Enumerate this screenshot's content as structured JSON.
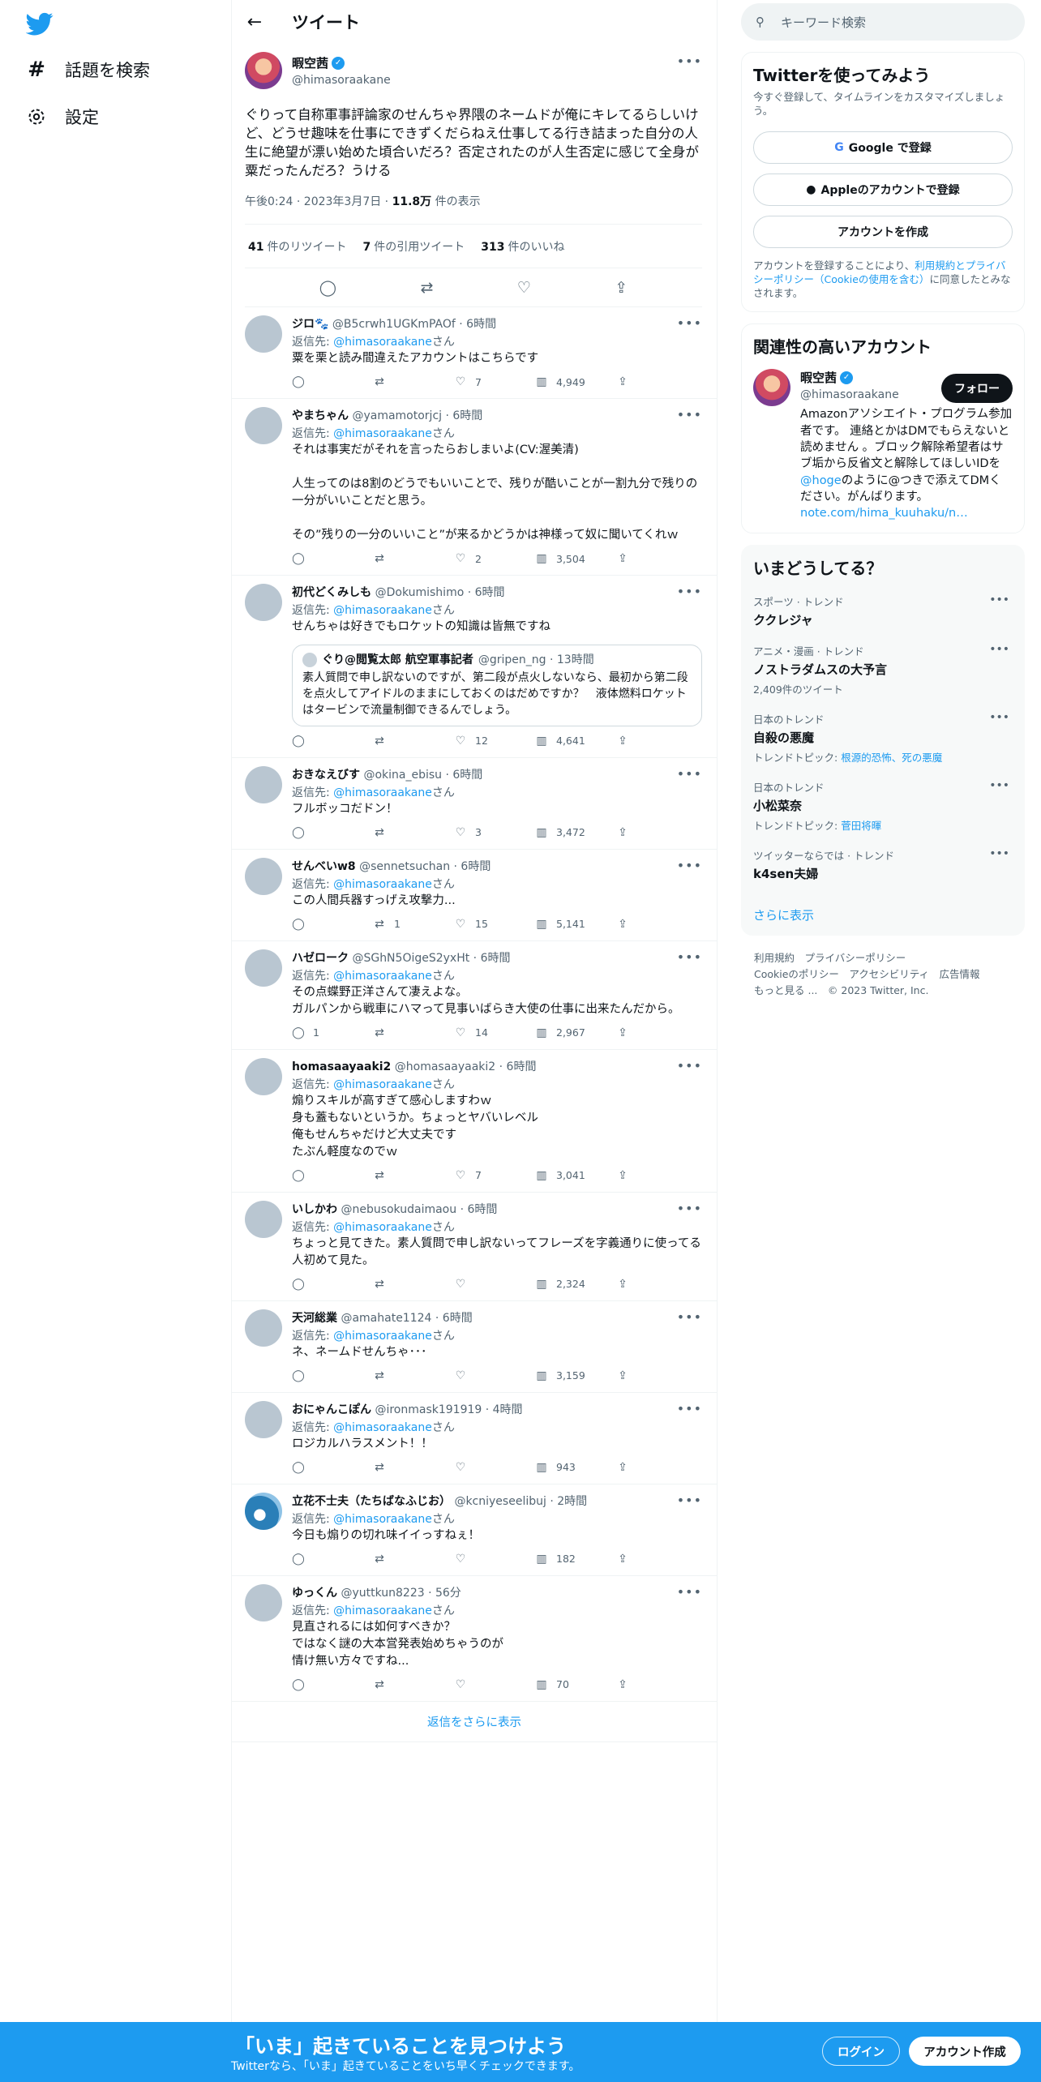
{
  "nav": {
    "explore_label": "話題を検索",
    "settings_label": "設定"
  },
  "header": {
    "title": "ツイート"
  },
  "focal": {
    "name": "暇空茜",
    "handle": "@himasoraakane",
    "text": "ぐりって自称軍事評論家のせんちゃ界隈のネームドが俺にキレてるらしいけど、どうせ趣味を仕事にできずくだらねえ仕事してる行き詰まった自分の人生に絶望が漂い始めた頃合いだろ？否定されたのが人生否定に感じて全身が粟だったんだろ？うける",
    "time": "午後0:24 · 2023年3月7日 · ",
    "views": "11.8万",
    "views_suffix": " 件の表示",
    "retweets": "41",
    "retweets_label": "件のリツイート",
    "quotes": "7",
    "quotes_label": "件の引用ツイート",
    "likes": "313",
    "likes_label": "件のいいね"
  },
  "replies": [
    {
      "name": "ジロ🐾",
      "meta": "@B5crwh1UGKmPAOf · 6時間",
      "to_prefix": "返信先: ",
      "to": "@himasoraakane",
      "to_suffix": "さん",
      "text": "粟を栗と読み間違えたアカウントはこちらです",
      "comments": "",
      "retweets": "",
      "likes": "7",
      "views": "4,949"
    },
    {
      "name": "やまちゃん",
      "meta": "@yamamotorjcj · 6時間",
      "to_prefix": "返信先: ",
      "to": "@himasoraakane",
      "to_suffix": "さん",
      "text": "それは事実だがそれを言ったらおしまいよ(CV:渥美清)\n\n人生ってのは8割のどうでもいいことで、残りが酷いことが一割九分で残りの一分がいいことだと思う。\n\nその”残りの一分のいいこと”が来るかどうかは神様って奴に聞いてくれｗ",
      "comments": "",
      "retweets": "",
      "likes": "2",
      "views": "3,504"
    },
    {
      "name": "初代どくみしも",
      "meta": "@Dokumishimo · 6時間",
      "to_prefix": "返信先: ",
      "to": "@himasoraakane",
      "to_suffix": "さん",
      "text": "せんちゃは好きでもロケットの知識は皆無ですね",
      "comments": "",
      "retweets": "",
      "likes": "12",
      "views": "4,641",
      "quote": {
        "name": "ぐり@閲覧太郎 航空軍事記者",
        "meta": "@gripen_ng · 13時間",
        "text": "素人質問で申し訳ないのですが、第二段が点火しないなら、最初から第二段を点火してアイドルのままにしておくのはだめですか？　液体燃料ロケットはタービンで流量制御できるんでしょう。"
      }
    },
    {
      "name": "おきなえびす",
      "meta": "@okina_ebisu · 6時間",
      "to_prefix": "返信先: ",
      "to": "@himasoraakane",
      "to_suffix": "さん",
      "text": "フルボッコだドン！",
      "comments": "",
      "retweets": "",
      "likes": "3",
      "views": "3,472"
    },
    {
      "name": "せんべいw8",
      "meta": "@sennetsuchan · 6時間",
      "to_prefix": "返信先: ",
      "to": "@himasoraakane",
      "to_suffix": "さん",
      "text": "この人間兵器すっげえ攻撃力...",
      "comments": "",
      "retweets": "1",
      "likes": "15",
      "views": "5,141"
    },
    {
      "name": "ハゼローク",
      "meta": "@SGhN5OigeS2yxHt · 6時間",
      "to_prefix": "返信先: ",
      "to": "@himasoraakane",
      "to_suffix": "さん",
      "text": "その点蝶野正洋さんて凄えよな。\nガルパンから戦車にハマって見事いばらき大使の仕事に出来たんだから。",
      "comments": "1",
      "retweets": "",
      "likes": "14",
      "views": "2,967"
    },
    {
      "name": "homasaayaaki2",
      "meta": "@homasaayaaki2 · 6時間",
      "to_prefix": "返信先: ",
      "to": "@himasoraakane",
      "to_suffix": "さん",
      "text": "煽りスキルが高すぎて感心しますわｗ\n身も蓋もないというか。ちょっとヤバいレベル\n俺もせんちゃだけど大丈夫です\nたぶん軽度なのでｗ",
      "comments": "",
      "retweets": "",
      "likes": "7",
      "views": "3,041"
    },
    {
      "name": "いしかわ",
      "meta": "@nebusokudaimaou · 6時間",
      "to_prefix": "返信先: ",
      "to": "@himasoraakane",
      "to_suffix": "さん",
      "text": "ちょっと見てきた。素人質問で申し訳ないってフレーズを字義通りに使ってる人初めて見た。",
      "comments": "",
      "retweets": "",
      "likes": "",
      "views": "2,324"
    },
    {
      "name": "天河総業",
      "meta": "@amahate1124 · 6時間",
      "to_prefix": "返信先: ",
      "to": "@himasoraakane",
      "to_suffix": "さん",
      "text": "ネ、ネームドせんちゃ･･･",
      "comments": "",
      "retweets": "",
      "likes": "",
      "views": "3,159"
    },
    {
      "name": "おにゃんこぽん",
      "meta": "@ironmask191919 · 4時間",
      "to_prefix": "返信先: ",
      "to": "@himasoraakane",
      "to_suffix": "さん",
      "text": "ロジカルハラスメント！！",
      "comments": "",
      "retweets": "",
      "likes": "",
      "views": "943"
    },
    {
      "name": "立花不士夫（たちばなふじお）",
      "meta": "@kcniyeseelibuj · 2時間",
      "to_prefix": "返信先: ",
      "to": "@himasoraakane",
      "to_suffix": "さん",
      "text": "今日も煽りの切れ味イイっすねぇ！",
      "comments": "",
      "retweets": "",
      "likes": "",
      "views": "182"
    },
    {
      "name": "ゆっくん",
      "meta": "@yuttkun8223 · 56分",
      "to_prefix": "返信先: ",
      "to": "@himasoraakane",
      "to_suffix": "さん",
      "text": "見直されるには如何すべきか？\nではなく謎の大本営発表始めちゃうのが\n情け無い方々ですね...",
      "comments": "",
      "retweets": "",
      "likes": "",
      "views": "70"
    }
  ],
  "show_more_replies": "返信をさらに表示",
  "search": {
    "placeholder": "キーワード検索"
  },
  "signup_card": {
    "title": "Twitterを使ってみよう",
    "subtitle": "今すぐ登録して、タイムラインをカスタマイズしましょう。",
    "google": "Google で登録",
    "apple": "Appleのアカウントで登録",
    "create": "アカウントを作成",
    "fine_1": "アカウントを登録することにより、",
    "fine_link": "利用規約とプライバシーポリシー（Cookieの使用を含む）",
    "fine_2": "に同意したとみなされます。"
  },
  "related": {
    "title": "関連性の高いアカウント",
    "name": "暇空茜",
    "handle": "@himasoraakane",
    "follow": "フォロー",
    "bio_1": "Amazonアソシエイト・プログラム参加者です。 連絡とかはDMでもらえないと読めません 。ブロック解除希望者はサブ垢から反省文と解除してほしいIDを",
    "bio_link": "@hoge",
    "bio_2": "のように@つきで添えてDMください。がんばります。",
    "bio_url": "note.com/hima_kuuhaku/n…"
  },
  "trends": {
    "title": "いまどうしてる？",
    "items": [
      {
        "cat": "スポーツ · トレンド",
        "name": "ククレジャ",
        "info_prefix": "",
        "info_link": ""
      },
      {
        "cat": "アニメ・漫画 · トレンド",
        "name": "ノストラダムスの大予言",
        "info_prefix": "2,409件のツイート",
        "info_link": ""
      },
      {
        "cat": "日本のトレンド",
        "name": "自殺の悪魔",
        "info_prefix": "トレンドトピック: ",
        "info_link": "根源的恐怖、死の悪魔"
      },
      {
        "cat": "日本のトレンド",
        "name": "小松菜奈",
        "info_prefix": "トレンドトピック: ",
        "info_link": "菅田将暉"
      },
      {
        "cat": "ツイッターならでは · トレンド",
        "name": "k4sen夫婦",
        "info_prefix": "",
        "info_link": ""
      }
    ],
    "more": "さらに表示"
  },
  "footer": {
    "line1": "利用規約　プライバシーポリシー",
    "line2": "Cookieのポリシー　アクセシビリティ　広告情報",
    "line3": "もっと見る ...　© 2023 Twitter, Inc."
  },
  "banner": {
    "title": "「いま」起きていることを見つけよう",
    "subtitle": "Twitterなら、「いま」起きていることをいち早くチェックできます。",
    "login": "ログイン",
    "signup": "アカウント作成"
  },
  "colors": {
    "accent": "#1d9bf0",
    "text": "#0f1419",
    "muted": "#536471",
    "border": "#eff3f4"
  }
}
